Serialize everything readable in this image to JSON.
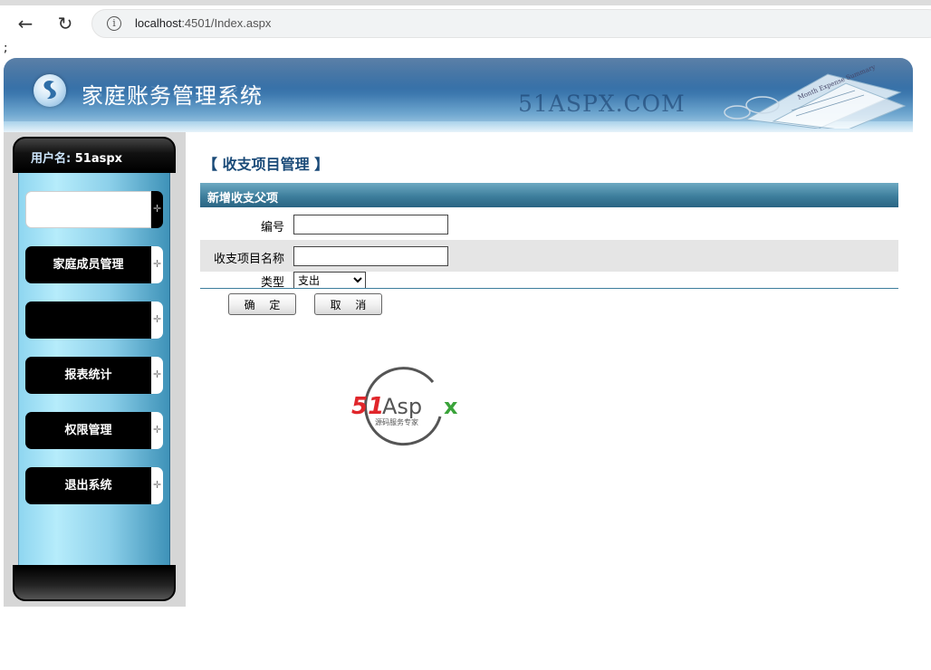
{
  "browser": {
    "url_host": "localhost",
    "url_rest": ":4501/Index.aspx",
    "page_glyph": ";"
  },
  "banner": {
    "title": "家庭账务管理系统",
    "watermark": "51ASPX.COM",
    "paper_text": "Month Expense Summary"
  },
  "sidebar": {
    "user_label": "用户名:",
    "user_name": "51aspx",
    "items": [
      {
        "label": "",
        "style": "white"
      },
      {
        "label": "家庭成员管理",
        "style": "black"
      },
      {
        "label": "",
        "style": "black"
      },
      {
        "label": "报表统计",
        "style": "black"
      },
      {
        "label": "权限管理",
        "style": "black"
      },
      {
        "label": "退出系统",
        "style": "black"
      }
    ]
  },
  "content": {
    "page_title": "【 收支项目管理 】",
    "form_header": "新增收支父项",
    "fields": {
      "code_label": "编号",
      "code_value": "",
      "name_label": "收支项目名称",
      "name_value": "",
      "type_label": "类型",
      "type_selected": "支出"
    },
    "buttons": {
      "ok": "确 定",
      "cancel": "取 消"
    }
  },
  "brand_logo": {
    "text_red": "51",
    "text_dark": "Asp",
    "text_green": "x",
    "subtitle": "源码服务专家",
    "colors": {
      "red": "#e0262b",
      "dark": "#555555",
      "green": "#3aa33a"
    }
  }
}
